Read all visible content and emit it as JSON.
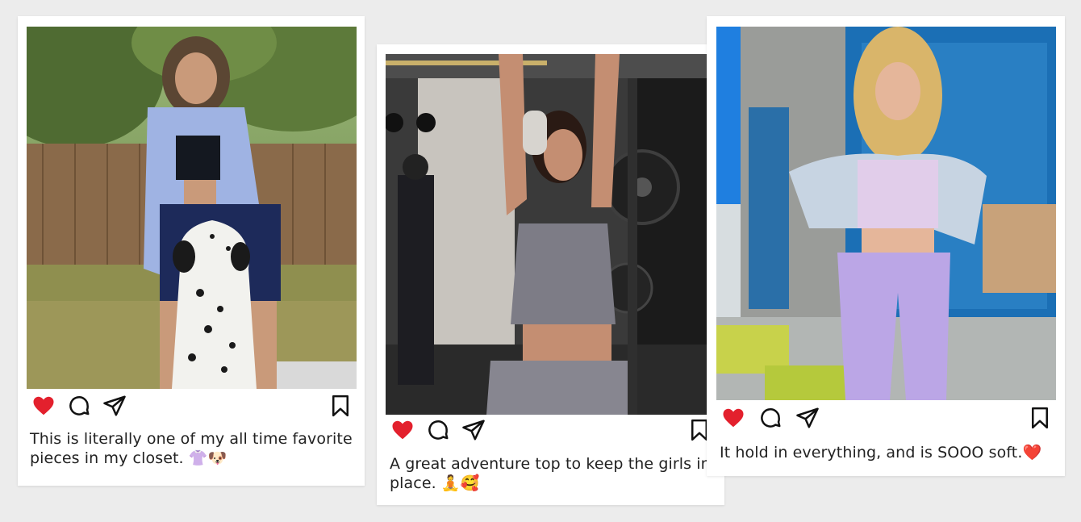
{
  "posts": [
    {
      "caption": "This is literally one of my all time favorite pieces in my closet. 👚🐶",
      "icons": [
        "heart-icon",
        "comment-icon",
        "share-icon",
        "bookmark-icon"
      ],
      "liked": true
    },
    {
      "caption": "A great adventure top to keep the girls in place. 🧘🥰",
      "icons": [
        "heart-icon",
        "comment-icon",
        "share-icon",
        "bookmark-icon"
      ],
      "liked": true
    },
    {
      "caption": "It hold in everything, and is SOOO soft.❤️",
      "icons": [
        "heart-icon",
        "comment-icon",
        "share-icon",
        "bookmark-icon"
      ],
      "liked": true
    }
  ],
  "colors": {
    "background": "#ececec",
    "card": "#ffffff",
    "heart": "#e3202d",
    "text": "#222222"
  }
}
